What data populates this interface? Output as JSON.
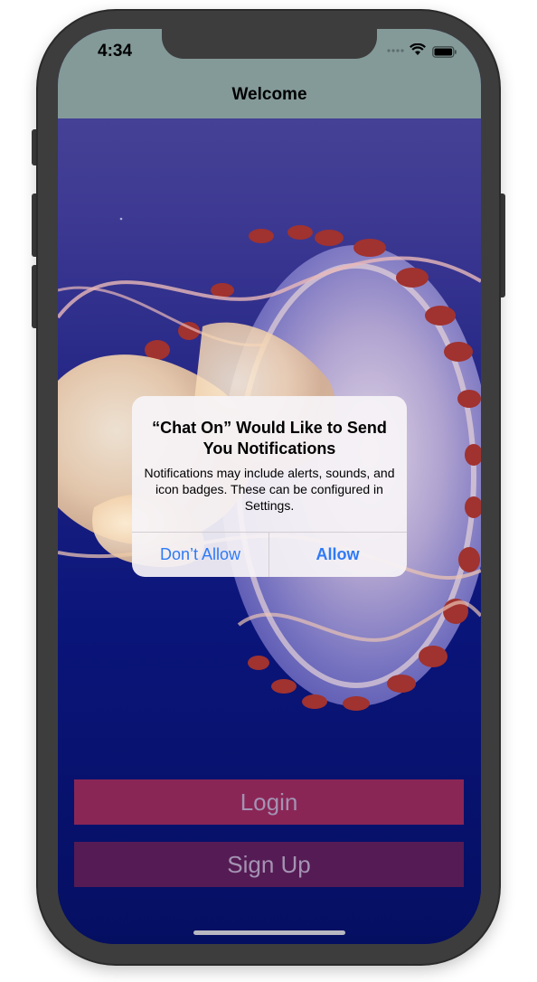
{
  "status_bar": {
    "time": "4:34",
    "signal_icon": "signal-dots-icon",
    "wifi_icon": "wifi-icon",
    "battery_icon": "battery-icon",
    "background_color": "#849a99"
  },
  "nav": {
    "title": "Welcome"
  },
  "alert": {
    "title": "“Chat On” Would Like to Send You Notifications",
    "message": "Notifications may include alerts, sounds, and icon badges. These can be configured in Settings.",
    "deny_label": "Don’t Allow",
    "allow_label": "Allow",
    "button_color": "#2f7af6"
  },
  "actions": {
    "login_label": "Login",
    "signup_label": "Sign Up",
    "login_color": "#8a2656",
    "signup_color": "#551b54"
  }
}
